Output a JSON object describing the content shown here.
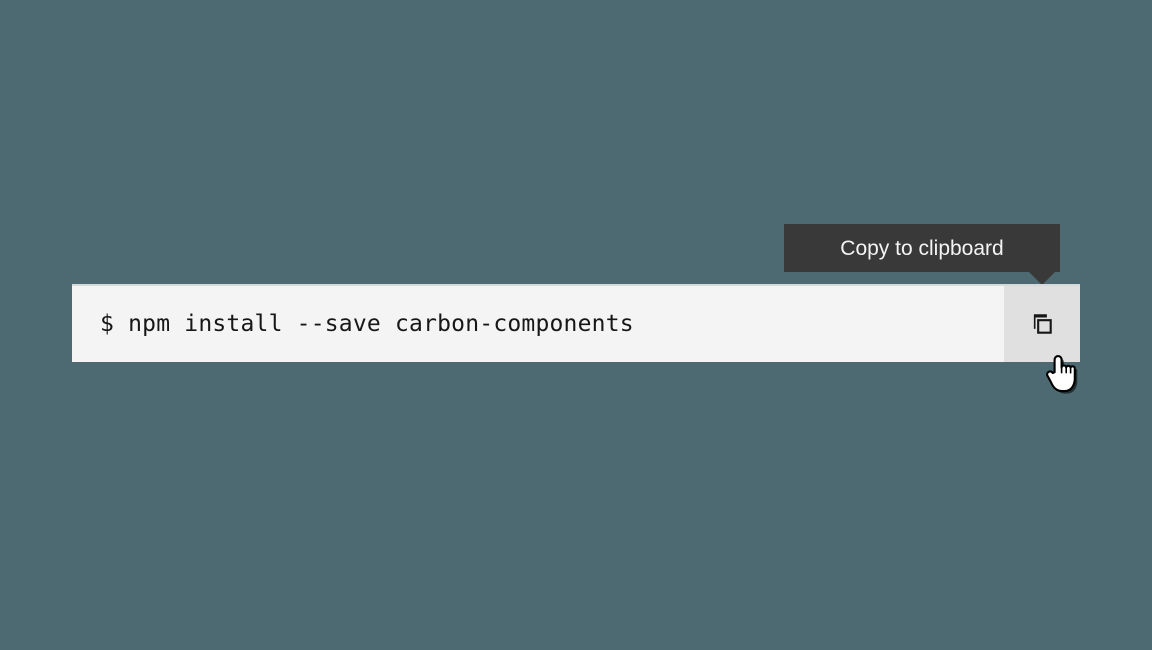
{
  "page": {
    "background_color": "#4d6a72"
  },
  "snippet": {
    "code": "$ npm install --save carbon-components",
    "background_color": "#f4f4f4",
    "text_color": "#171717",
    "border_top_color": "#d6d9da"
  },
  "copy_button": {
    "icon": "copy-icon",
    "aria_label": "Copy to clipboard",
    "background_color": "#e0e0e0",
    "state": "hover"
  },
  "tooltip": {
    "label": "Copy to clipboard",
    "background_color": "#393939",
    "text_color": "#f4f4f4",
    "caret_position": "bottom-right"
  },
  "cursor": {
    "type": "pointer-hand-icon"
  }
}
